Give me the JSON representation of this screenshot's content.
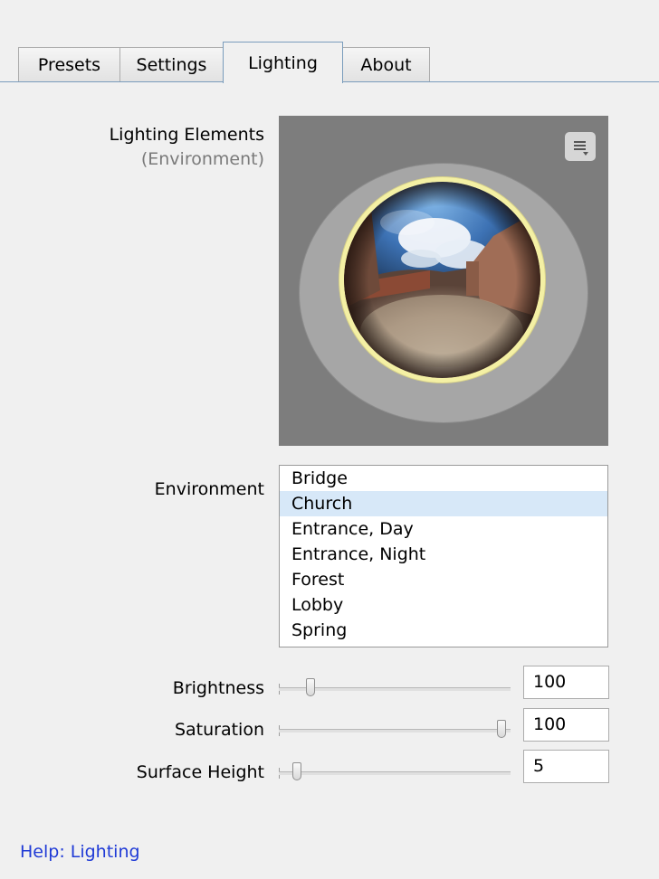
{
  "tabs": [
    {
      "label": "Presets",
      "active": false
    },
    {
      "label": "Settings",
      "active": false
    },
    {
      "label": "Lighting",
      "active": true
    },
    {
      "label": "About",
      "active": false
    }
  ],
  "lighting_elements": {
    "title": "Lighting Elements",
    "subtitle": "(Environment)"
  },
  "environment": {
    "label": "Environment",
    "items": [
      "Bridge",
      "Church",
      "Entrance, Day",
      "Entrance, Night",
      "Forest",
      "Lobby",
      "Spring"
    ],
    "selected": "Church"
  },
  "sliders": {
    "brightness": {
      "label": "Brightness",
      "value": "100",
      "level": 0.12
    },
    "saturation": {
      "label": "Saturation",
      "value": "100",
      "level": 0.98
    },
    "surface_height": {
      "label": "Surface Height",
      "value": "5",
      "level": 0.06
    }
  },
  "icons": {
    "preview_menu": "menu-lines-icon"
  },
  "colors": {
    "selection": "#d7e8f8",
    "halo": "#f4f0a4",
    "link": "#1f3ad6"
  },
  "help_link": "Help: Lighting"
}
